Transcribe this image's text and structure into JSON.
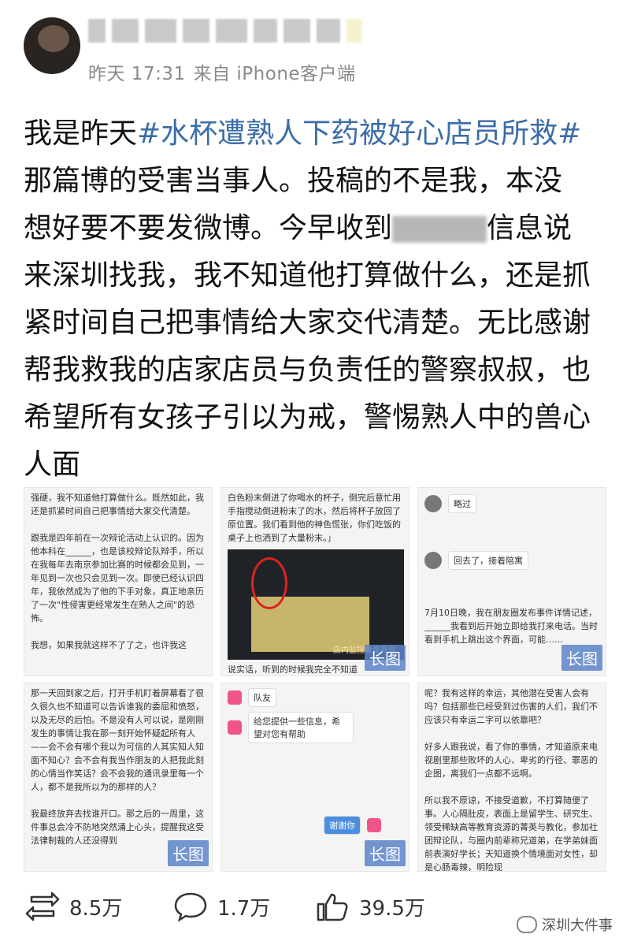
{
  "post": {
    "time": "昨天 17:31",
    "source": "来自 iPhone客户端",
    "text_before_hashtag": "我是昨天",
    "hashtag": "#水杯遭熟人下药被好心店员所救#",
    "text_line2": "那篇博的受害当事人。投稿的不是我，本没",
    "text_line3a": "想好要不要发微博。今早收到",
    "text_line3b": "信息说",
    "text_rest": "来深圳找我，我不知道他打算做什么，还是抓紧时间自己把事情给大家交代清楚。无比感谢帮我救我的店家店员与负责任的警察叔叔，也希望所有女孩子引以为戒，警惕熟人中的兽心人面"
  },
  "images": [
    {
      "text": "强硬，我不知道他打算做什么。既然如此，我还是抓紧时间自己把事情给大家交代清楚。\n\n跟我是四年前在一次辩论活动上认识的。因为他本科在______，也是该校辩论队辩手，所以在我每年去南京参加比赛的时候都会见到，一年见到一次也只会见到一次。即使已经认识四年，我依然成为了他的下手对象，真正地亲历了一次\"性侵害更经常发生在熟人之间\"的恐怖。\n\n我想，如果我就这样不了了之，也许我这",
      "long_label": "长图"
    },
    {
      "text": "白色粉末倒进了你喝水的杯子，倒完后意忙用手指搅动倒进粉末了的水，然后将杯子放回了原位置。我们看到他的神色慌张，你们吃饭的桌子上也洒到了大量粉末。」",
      "cctv_label": "店内监控录像截图",
      "caption": "说实话，听到的时候我完全不知道",
      "long_label": "长图"
    },
    {
      "text": "7月10日晚，我在朋友圈发布事件详情记述，______我看到后开始立即给我打来电话。当时看到手机上跳出这个界面，可能……",
      "chat1": "略过",
      "chat2": "回去了，接着陪寓",
      "long_label": "长图"
    },
    {
      "text": "那一天回到家之后，打开手机盯着屏幕看了很久很久也不知道可以告诉谁我的委屈和愤怒，以及无尽的后怕。不是没有人可以说，是刚刚发生的事情让我在那一刻开始怀疑起所有人——会不会有哪个我以为可信的人其实知人知面不知心？会不会有我当作朋友的人把我此刻的心情当作笑话？会不会我的通讯录里每一个人，都不是我所以为的那样的人？\n\n我最终放弃去找谁开口。那之后的一周里，这件事总会冷不防地突然涌上心头，提醒我这受法律制裁的人还没得到",
      "long_label": "长图"
    },
    {
      "text": "",
      "chat1": "队友",
      "chat2": "给您提供一些信息，希望对您有帮助",
      "chat3": "谢谢你",
      "long_label": "长图"
    },
    {
      "text": "呢？我有这样的幸运，其他潜在受害人会有吗？包括那些已经受到过伤害的人们，我们不应该只有幸运二字可以依靠吧？\n\n好多人跟我说，看了你的事情，才知道原来电视剧里那些败坏的人心、卑劣的行径、罪恶的企图，离我们一点都不远啊。\n\n所以我不原谅，不接受道歉，不打算随便了事。人心隔肚皮，表面上是留学生、研究生、领受稀缺高等教育资源的菁英与教化，参加社团辩论队，与圈内前辈称兄道弟，在学弟妹面前表演好学长；天知道换个情境面对女性，却是心肠毒辣，明险现",
      "long_label": "长图"
    }
  ],
  "actions": {
    "repost_count": "8.5万",
    "comment_count": "1.7万",
    "like_count": "39.5万"
  },
  "watermark": "深圳大件事",
  "icons": [
    "repost-icon",
    "comment-icon",
    "like-icon",
    "wechat-icon"
  ]
}
